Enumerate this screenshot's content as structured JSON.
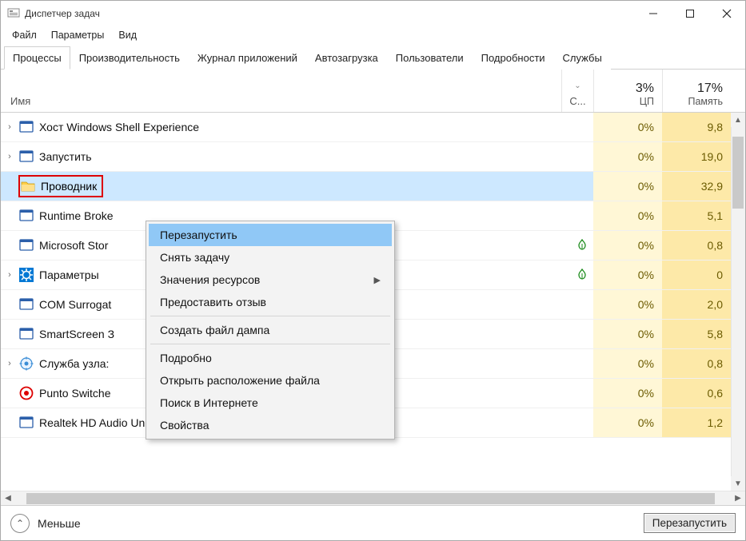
{
  "window": {
    "title": "Диспетчер задач"
  },
  "menubar": {
    "file": "Файл",
    "options": "Параметры",
    "view": "Вид"
  },
  "tabs": {
    "processes": "Процессы",
    "performance": "Производительность",
    "app_history": "Журнал приложений",
    "startup": "Автозагрузка",
    "users": "Пользователи",
    "details": "Подробности",
    "services": "Службы"
  },
  "columns": {
    "name": "Имя",
    "status": "С...",
    "cpu_pct": "3%",
    "cpu_label": "ЦП",
    "mem_pct": "17%",
    "mem_label": "Память"
  },
  "processes": [
    {
      "expand": true,
      "icon": "app",
      "name": "Хост Windows Shell Experience",
      "leaf": "",
      "cpu": "0%",
      "mem": "9,8"
    },
    {
      "expand": true,
      "icon": "app",
      "name": "Запустить",
      "leaf": "",
      "cpu": "0%",
      "mem": "19,0"
    },
    {
      "expand": false,
      "icon": "explorer",
      "name": "Проводник",
      "leaf": "",
      "cpu": "0%",
      "mem": "32,9",
      "selected": true,
      "highlight": true
    },
    {
      "expand": false,
      "icon": "app",
      "name": "Runtime Broke",
      "leaf": "",
      "cpu": "0%",
      "mem": "5,1"
    },
    {
      "expand": false,
      "icon": "app",
      "name": "Microsoft Stor",
      "leaf": "green",
      "cpu": "0%",
      "mem": "0,8"
    },
    {
      "expand": true,
      "icon": "settings",
      "name": "Параметры",
      "leaf": "green",
      "cpu": "0%",
      "mem": "0"
    },
    {
      "expand": false,
      "icon": "app",
      "name": "COM Surrogat",
      "leaf": "",
      "cpu": "0%",
      "mem": "2,0"
    },
    {
      "expand": false,
      "icon": "app",
      "name": "SmartScreen З",
      "leaf": "",
      "cpu": "0%",
      "mem": "5,8"
    },
    {
      "expand": true,
      "icon": "service",
      "name": "Служба узла:",
      "leaf": "",
      "cpu": "0%",
      "mem": "0,8"
    },
    {
      "expand": false,
      "icon": "punto",
      "name": "Punto Switche",
      "leaf": "",
      "cpu": "0%",
      "mem": "0,6"
    },
    {
      "expand": false,
      "icon": "app",
      "name": "Realtek HD Audio Universal Service",
      "leaf": "",
      "cpu": "0%",
      "mem": "1,2"
    }
  ],
  "context_menu": {
    "restart": "Перезапустить",
    "end_task": "Снять задачу",
    "resource_values": "Значения ресурсов",
    "feedback": "Предоставить отзыв",
    "create_dump": "Создать файл дампа",
    "details": "Подробно",
    "open_location": "Открыть расположение файла",
    "search_online": "Поиск в Интернете",
    "properties": "Свойства"
  },
  "footer": {
    "fewer": "Меньше",
    "restart_button": "Перезапустить"
  }
}
